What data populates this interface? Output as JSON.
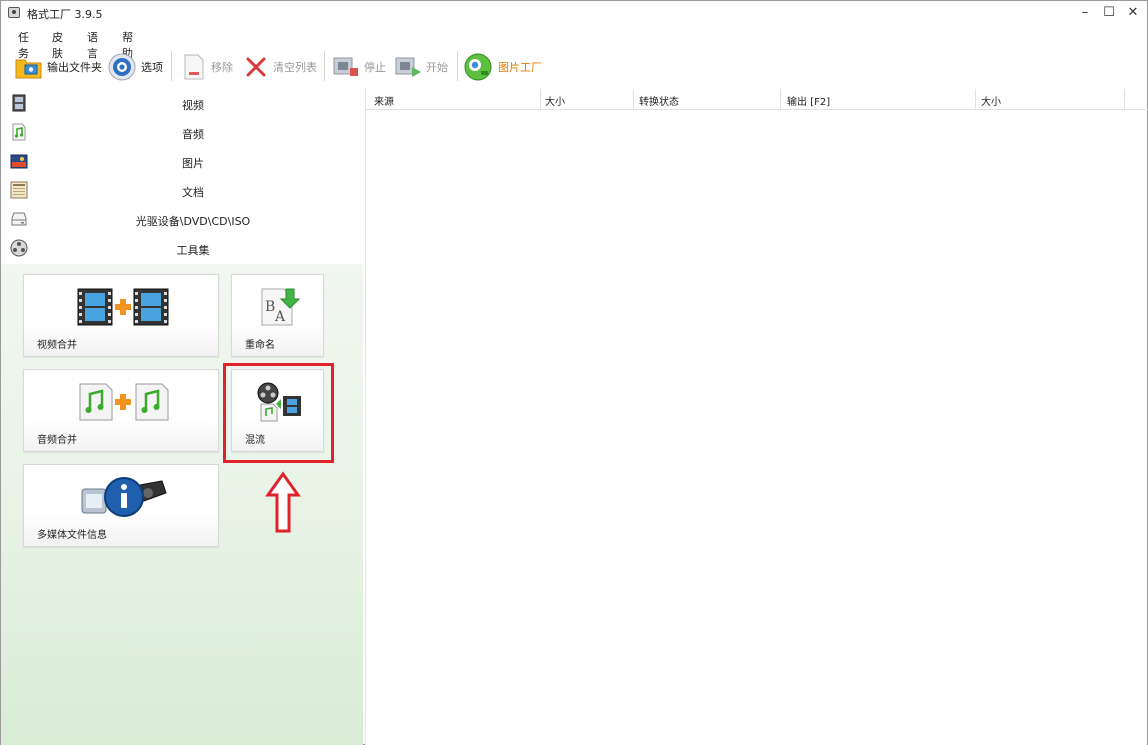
{
  "window": {
    "title": "格式工厂 3.9.5",
    "controls": {
      "minimize": "–",
      "maximize": "☐",
      "close": "✕"
    }
  },
  "menu": [
    "任务",
    "皮肤",
    "语言",
    "帮助"
  ],
  "toolbar": {
    "output_folder": "输出文件夹",
    "options": "选项",
    "remove": "移除",
    "clear_list": "清空列表",
    "stop": "停止",
    "start": "开始",
    "picture_factory": "图片工厂"
  },
  "categories": [
    {
      "label": "视频",
      "icon": "film-icon"
    },
    {
      "label": "音频",
      "icon": "music-icon"
    },
    {
      "label": "图片",
      "icon": "picture-icon"
    },
    {
      "label": "文档",
      "icon": "document-icon"
    },
    {
      "label": "光驱设备\\DVD\\CD\\ISO",
      "icon": "disc-drive-icon"
    },
    {
      "label": "工具集",
      "icon": "tools-reel-icon"
    }
  ],
  "tools": {
    "video_merge": "视频合并",
    "rename": "重命名",
    "audio_merge": "音频合并",
    "mux": "混流",
    "media_info": "多媒体文件信息"
  },
  "table": {
    "columns": [
      "来源",
      "大小",
      "转换状态",
      "输出 [F2]",
      "大小"
    ]
  },
  "colors": {
    "highlight": "#e0232b",
    "panel_green": "#d9ecd6",
    "accent_orange": "#f29221"
  }
}
